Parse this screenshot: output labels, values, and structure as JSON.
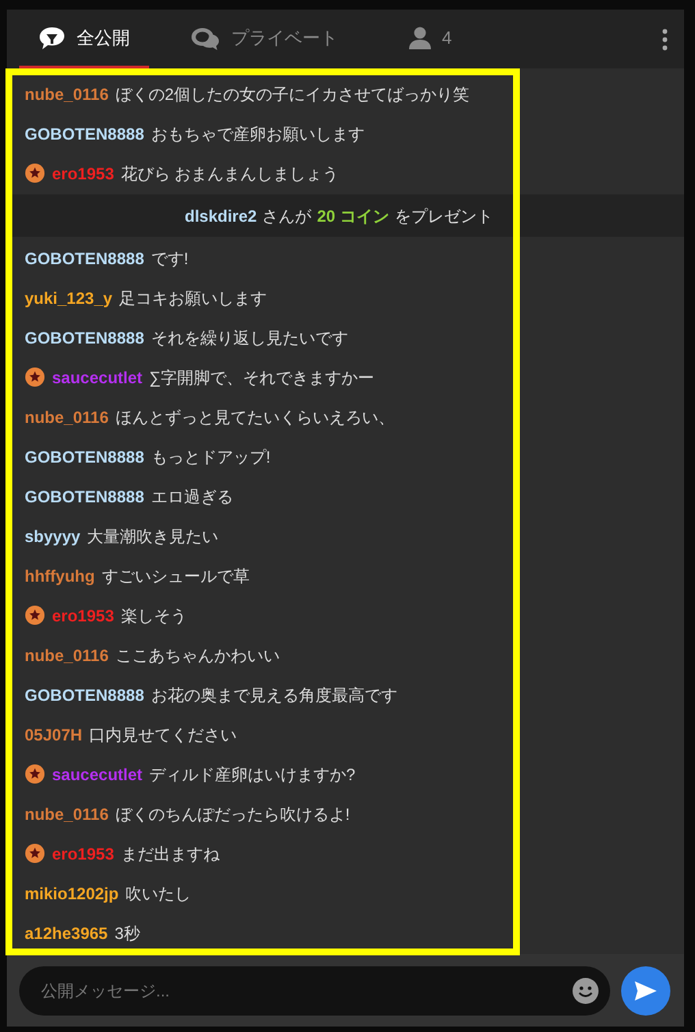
{
  "tabs": [
    {
      "kind": "public",
      "label": "全公開",
      "selected": true
    },
    {
      "kind": "private",
      "label": "プライベート",
      "selected": false
    },
    {
      "kind": "users",
      "label": "4",
      "selected": false
    }
  ],
  "messages": [
    {
      "kind": "chat",
      "user": "nube_0116",
      "color": "#d97a3a",
      "badge": false,
      "text": "ぼくの2個したの女の子にイカさせてばっかり笑"
    },
    {
      "kind": "chat",
      "user": "GOBOTEN8888",
      "color": "#b9dcf5",
      "badge": false,
      "text": "おもちゃで産卵お願いします"
    },
    {
      "kind": "chat",
      "user": "ero1953",
      "color": "#f02020",
      "badge": true,
      "text": "花びら おまんまんしましょう"
    },
    {
      "kind": "gift",
      "user": "dlskdire2",
      "text_before": "さんが",
      "amount": "20 コイン",
      "text_after": "をプレゼント"
    },
    {
      "kind": "chat",
      "user": "GOBOTEN8888",
      "color": "#b9dcf5",
      "badge": false,
      "text": "です!"
    },
    {
      "kind": "chat",
      "user": "yuki_123_y",
      "color": "#f5a623",
      "badge": false,
      "text": "足コキお願いします"
    },
    {
      "kind": "chat",
      "user": "GOBOTEN8888",
      "color": "#b9dcf5",
      "badge": false,
      "text": "それを繰り返し見たいです"
    },
    {
      "kind": "chat",
      "user": "saucecutlet",
      "color": "#b530f0",
      "badge": true,
      "text": "∑字開脚で、それできますかー"
    },
    {
      "kind": "chat",
      "user": "nube_0116",
      "color": "#d97a3a",
      "badge": false,
      "text": "ほんとずっと見てたいくらいえろい、"
    },
    {
      "kind": "chat",
      "user": "GOBOTEN8888",
      "color": "#b9dcf5",
      "badge": false,
      "text": "もっとドアップ!"
    },
    {
      "kind": "chat",
      "user": "GOBOTEN8888",
      "color": "#b9dcf5",
      "badge": false,
      "text": "エロ過ぎる"
    },
    {
      "kind": "chat",
      "user": "sbyyyy",
      "color": "#b9dcf5",
      "badge": false,
      "text": "大量潮吹き見たい"
    },
    {
      "kind": "chat",
      "user": "hhffyuhg",
      "color": "#d97a3a",
      "badge": false,
      "text": "すごいシュールで草"
    },
    {
      "kind": "chat",
      "user": "ero1953",
      "color": "#f02020",
      "badge": true,
      "text": "楽しそう"
    },
    {
      "kind": "chat",
      "user": "nube_0116",
      "color": "#d97a3a",
      "badge": false,
      "text": "ここあちゃんかわいい"
    },
    {
      "kind": "chat",
      "user": "GOBOTEN8888",
      "color": "#b9dcf5",
      "badge": false,
      "text": "お花の奥まで見える角度最高です"
    },
    {
      "kind": "chat",
      "user": "05J07H",
      "color": "#d97a3a",
      "badge": false,
      "text": "口内見せてください"
    },
    {
      "kind": "chat",
      "user": "saucecutlet",
      "color": "#b530f0",
      "badge": true,
      "text": "ディルド産卵はいけますか?"
    },
    {
      "kind": "chat",
      "user": "nube_0116",
      "color": "#d97a3a",
      "badge": false,
      "text": "ぼくのちんぽだったら吹けるよ!"
    },
    {
      "kind": "chat",
      "user": "ero1953",
      "color": "#f02020",
      "badge": true,
      "text": "まだ出ますね"
    },
    {
      "kind": "chat",
      "user": "mikio1202jp",
      "color": "#f5a623",
      "badge": false,
      "text": "吹いたし"
    },
    {
      "kind": "chat",
      "user": "a12he3965",
      "color": "#f5a623",
      "badge": false,
      "text": "3秒"
    }
  ],
  "input": {
    "placeholder": "公開メッセージ..."
  }
}
